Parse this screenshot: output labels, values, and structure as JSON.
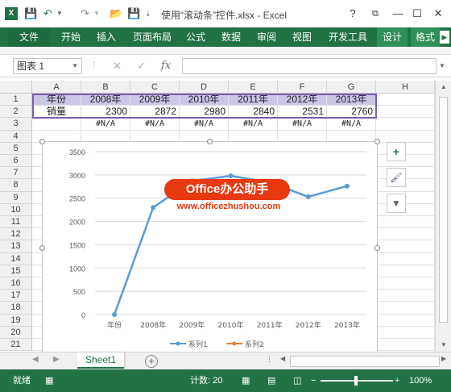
{
  "window": {
    "title": "使用“滚动条”控件.xlsx - Excel",
    "help": "?",
    "restore_ribbon": "⧉",
    "minimize": "—",
    "maximize": "☐",
    "close": "✕"
  },
  "ribbon_tabs": [
    "文件",
    "开始",
    "插入",
    "页面布局",
    "公式",
    "数据",
    "审阅",
    "视图",
    "开发工具",
    "设计",
    "格式"
  ],
  "formula_bar": {
    "name_box": "图表 1",
    "fx": "fx",
    "cancel": "✕",
    "enter": "✓",
    "value": ""
  },
  "columns": [
    "A",
    "B",
    "C",
    "D",
    "E",
    "F",
    "G",
    "H"
  ],
  "rows": [
    "1",
    "2",
    "3",
    "4",
    "5",
    "6",
    "7",
    "8",
    "9",
    "10",
    "11",
    "12",
    "13",
    "14",
    "15",
    "16",
    "17",
    "18",
    "19",
    "20",
    "21"
  ],
  "sheet": {
    "row1": [
      "年份",
      "2008年",
      "2009年",
      "2010年",
      "2011年",
      "2012年",
      "2013年"
    ],
    "row2": [
      "销量",
      "2300",
      "2872",
      "2980",
      "2840",
      "2531",
      "2760"
    ],
    "row3": [
      "",
      "#N/A",
      "#N/A",
      "#N/A",
      "#N/A",
      "#N/A",
      "#N/A"
    ]
  },
  "chart_data": {
    "type": "line",
    "categories": [
      "年份",
      "2008年",
      "2009年",
      "2010年",
      "2011年",
      "2012年",
      "2013年"
    ],
    "series": [
      {
        "name": "系列1",
        "values": [
          0,
          2300,
          2872,
          2980,
          2840,
          2531,
          2760
        ],
        "color": "#5b9bd5"
      },
      {
        "name": "系列2",
        "values": [
          null,
          null,
          null,
          null,
          null,
          null,
          null
        ],
        "color": "#ed7d31"
      }
    ],
    "y_ticks": [
      "0",
      "500",
      "1000",
      "1500",
      "2000",
      "2500",
      "3000",
      "3500"
    ],
    "ylim": [
      0,
      3500
    ],
    "grid": true,
    "legend": "bottom"
  },
  "watermark": {
    "title": "Office办公助手",
    "url": "www.officezhushou.com"
  },
  "chart_tools": {
    "add": "+",
    "style": "🖌",
    "filter": "▼"
  },
  "sheet_tabs": {
    "active": "Sheet1",
    "add": "+"
  },
  "status": {
    "mode": "就绪",
    "count": "计数: 20",
    "zoom": "100%",
    "minus": "−",
    "plus": "+"
  },
  "colors": {
    "excel_green": "#217346",
    "header_fill": "#c9c6e6",
    "selection": "#7a5eab"
  }
}
